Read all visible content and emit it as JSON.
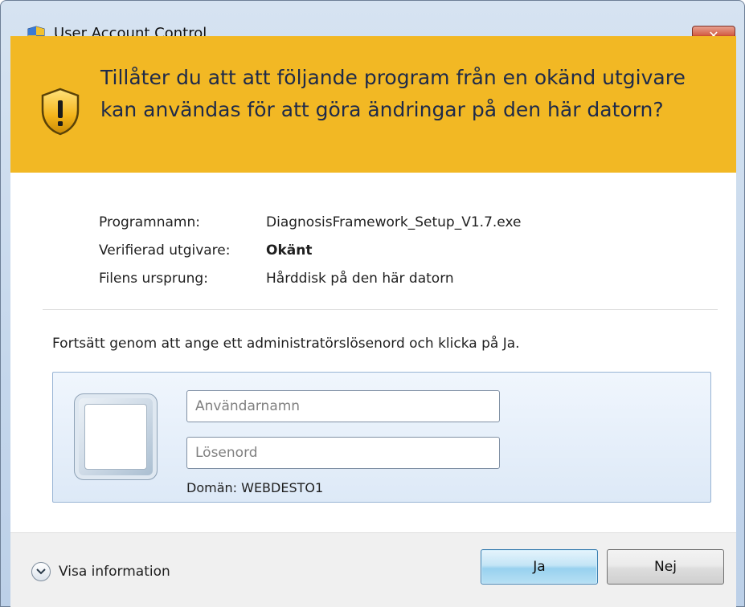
{
  "window": {
    "title": "User Account Control",
    "close_label": "✕"
  },
  "banner": {
    "question": "Tillåter du att att följande program från en okänd utgivare kan användas för att göra ändringar på den här datorn?",
    "background_color": "#f2b824"
  },
  "details": {
    "program_name_label": "Programnamn:",
    "program_name_value": "DiagnosisFramework_Setup_V1.7.exe",
    "publisher_label": "Verifierad utgivare:",
    "publisher_value": "Okänt",
    "origin_label": "Filens ursprung:",
    "origin_value": "Hårddisk på den här datorn"
  },
  "instruction": "Fortsätt genom att ange ett administratörslösenord och klicka på Ja.",
  "credentials": {
    "username_placeholder": "Användarnamn",
    "password_placeholder": "Lösenord",
    "domain": "Domän: WEBDESTO1"
  },
  "footer": {
    "show_details_label": "Visa information",
    "yes_label": "Ja",
    "no_label": "Nej"
  },
  "icons": {
    "title_icon": "uac-shield-icon",
    "banner_icon": "warning-shield-icon",
    "toggle_icon": "chevron-down-icon"
  }
}
